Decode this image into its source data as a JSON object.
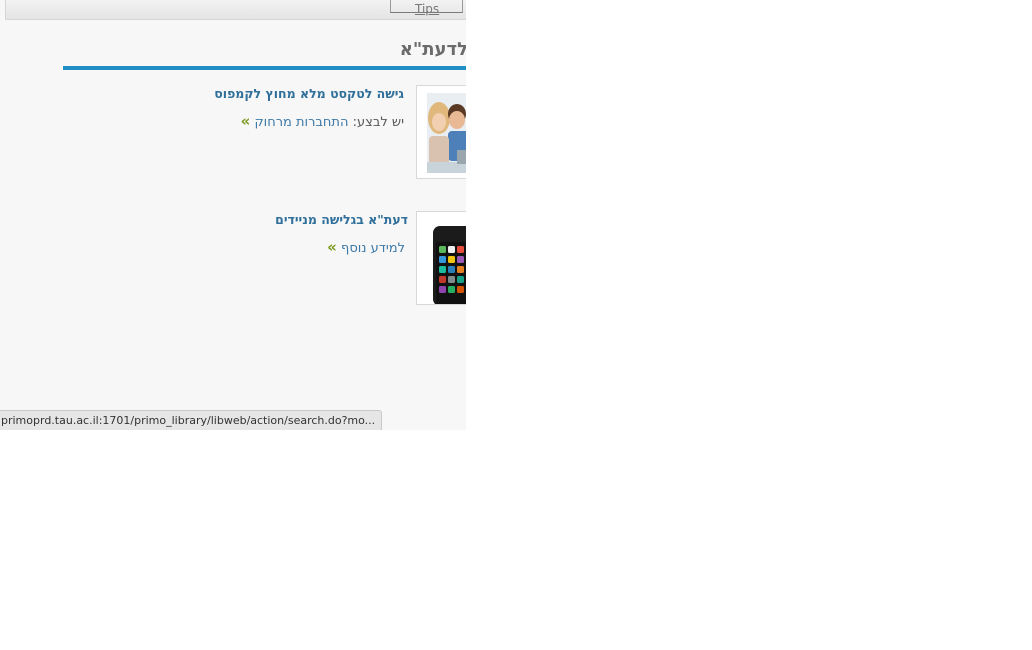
{
  "toolbar": {
    "tips_label": "Tips"
  },
  "section": {
    "title": "לדעת\"א"
  },
  "items": [
    {
      "title": "גישה לטקסט מלא מחוץ לקמפוס",
      "prefix": "יש לבצע:",
      "link": "התחברות מרחוק",
      "arrow": "»",
      "image": "family-laptop-photo"
    },
    {
      "title": "דעת\"א בגלישה מניידים",
      "link": "למידע נוסף",
      "arrow": "»",
      "image": "smartphone-photo"
    }
  ],
  "statusbar": {
    "url": "primoprd.tau.ac.il:1701/primo_library/libweb/action/search.do?mo..."
  },
  "colors": {
    "accent_rule": "#1f8fc6",
    "link_blue": "#3d7aa8",
    "title_blue": "#2f6f9a",
    "arrow_green": "#7a9a1e"
  }
}
